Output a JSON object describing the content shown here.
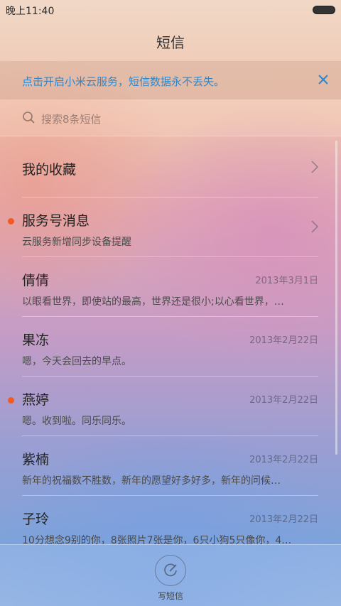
{
  "status_bar": {
    "time": "晚上11:40",
    "battery_icon": "battery-icon"
  },
  "header": {
    "title": "短信"
  },
  "banner": {
    "text": "点击开启小米云服务，短信数据永不丢失。",
    "close_icon": "close-icon",
    "accent_color": "#2f87c9"
  },
  "search": {
    "placeholder": "搜索8条短信",
    "icon": "search-icon"
  },
  "threads": [
    {
      "name": "我的收藏",
      "snippet": "",
      "date": "",
      "unread": false,
      "chevron": true
    },
    {
      "name": "服务号消息",
      "snippet": "云服务新增同步设备提醒",
      "date": "",
      "unread": true,
      "chevron": true
    },
    {
      "name": "倩倩",
      "snippet": "以眼看世界，即使站的最高，世界还是很小;以心看世界，…",
      "date": "2013年3月1日",
      "unread": false,
      "chevron": false
    },
    {
      "name": "果冻",
      "snippet": "嗯，今天会回去的早点。",
      "date": "2013年2月22日",
      "unread": false,
      "chevron": false
    },
    {
      "name": "燕婷",
      "snippet": "嗯。收到啦。同乐同乐。",
      "date": "2013年2月22日",
      "unread": true,
      "chevron": false
    },
    {
      "name": "紫楠",
      "snippet": "新年的祝福数不胜数，新年的愿望好多好多，新年的问候…",
      "date": "2013年2月22日",
      "unread": false,
      "chevron": false
    },
    {
      "name": "子玲",
      "snippet": "10分想念9别的你，8张照片7张是你，6只小狗5只像你，4…",
      "date": "2013年2月22日",
      "unread": false,
      "chevron": false
    }
  ],
  "unread_color": "#f35a1f",
  "bottom_bar": {
    "compose_label": "写短信",
    "compose_icon": "compose-icon"
  }
}
